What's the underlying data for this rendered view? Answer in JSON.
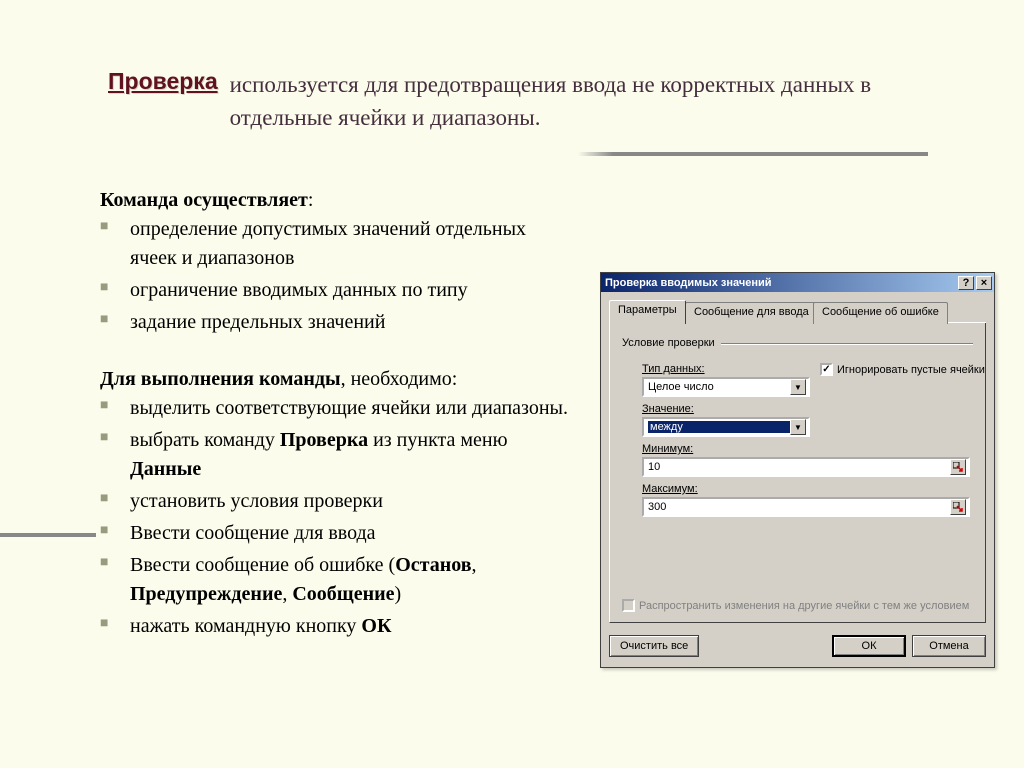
{
  "header": {
    "title": "Проверка",
    "description": "используется для предотвращения ввода не корректных данных в отдельные ячейки и диапазоны."
  },
  "section1": {
    "title_bold": "Команда осуществляет",
    "title_tail": ":",
    "items": [
      " определение допустимых значений отдельных ячеек и   диапазонов",
      "ограничение вводимых данных по типу",
      "задание предельных значений"
    ]
  },
  "section2": {
    "title_bold": "Для выполнения команды",
    "title_tail": ", необходимо:",
    "items": {
      "i0": "выделить соответствующие ячейки или диапазоны.",
      "i1_a": "выбрать команду ",
      "i1_b": "Проверка",
      "i1_c": " из пункта меню ",
      "i1_d": "Данные",
      "i2": "установить условия проверки",
      "i3": "Ввести сообщение для ввода",
      "i4_a": "Ввести сообщение об ошибке (",
      "i4_b": "Останов",
      "i4_c": ", ",
      "i4_d": "Предупреждение",
      "i4_e": ", ",
      "i4_f": "Сообщение",
      "i4_g": ")",
      "i5_a": "нажать командную кнопку ",
      "i5_b": "ОК"
    }
  },
  "dialog": {
    "title": "Проверка вводимых значений",
    "help": "?",
    "close": "×",
    "tabs": [
      "Параметры",
      "Сообщение для ввода",
      "Сообщение об ошибке"
    ],
    "group": "Условие проверки",
    "type_label": "Тип данных:",
    "type_value": "Целое число",
    "ignore_blank": "Игнорировать пустые ячейки",
    "value_label": "Значение:",
    "value_value": "между",
    "min_label": "Минимум:",
    "min_value": "10",
    "max_label": "Максимум:",
    "max_value": "300",
    "spread": "Распространить изменения на другие ячейки с тем же условием",
    "clear": "Очистить все",
    "ok": "ОК",
    "cancel": "Отмена"
  }
}
